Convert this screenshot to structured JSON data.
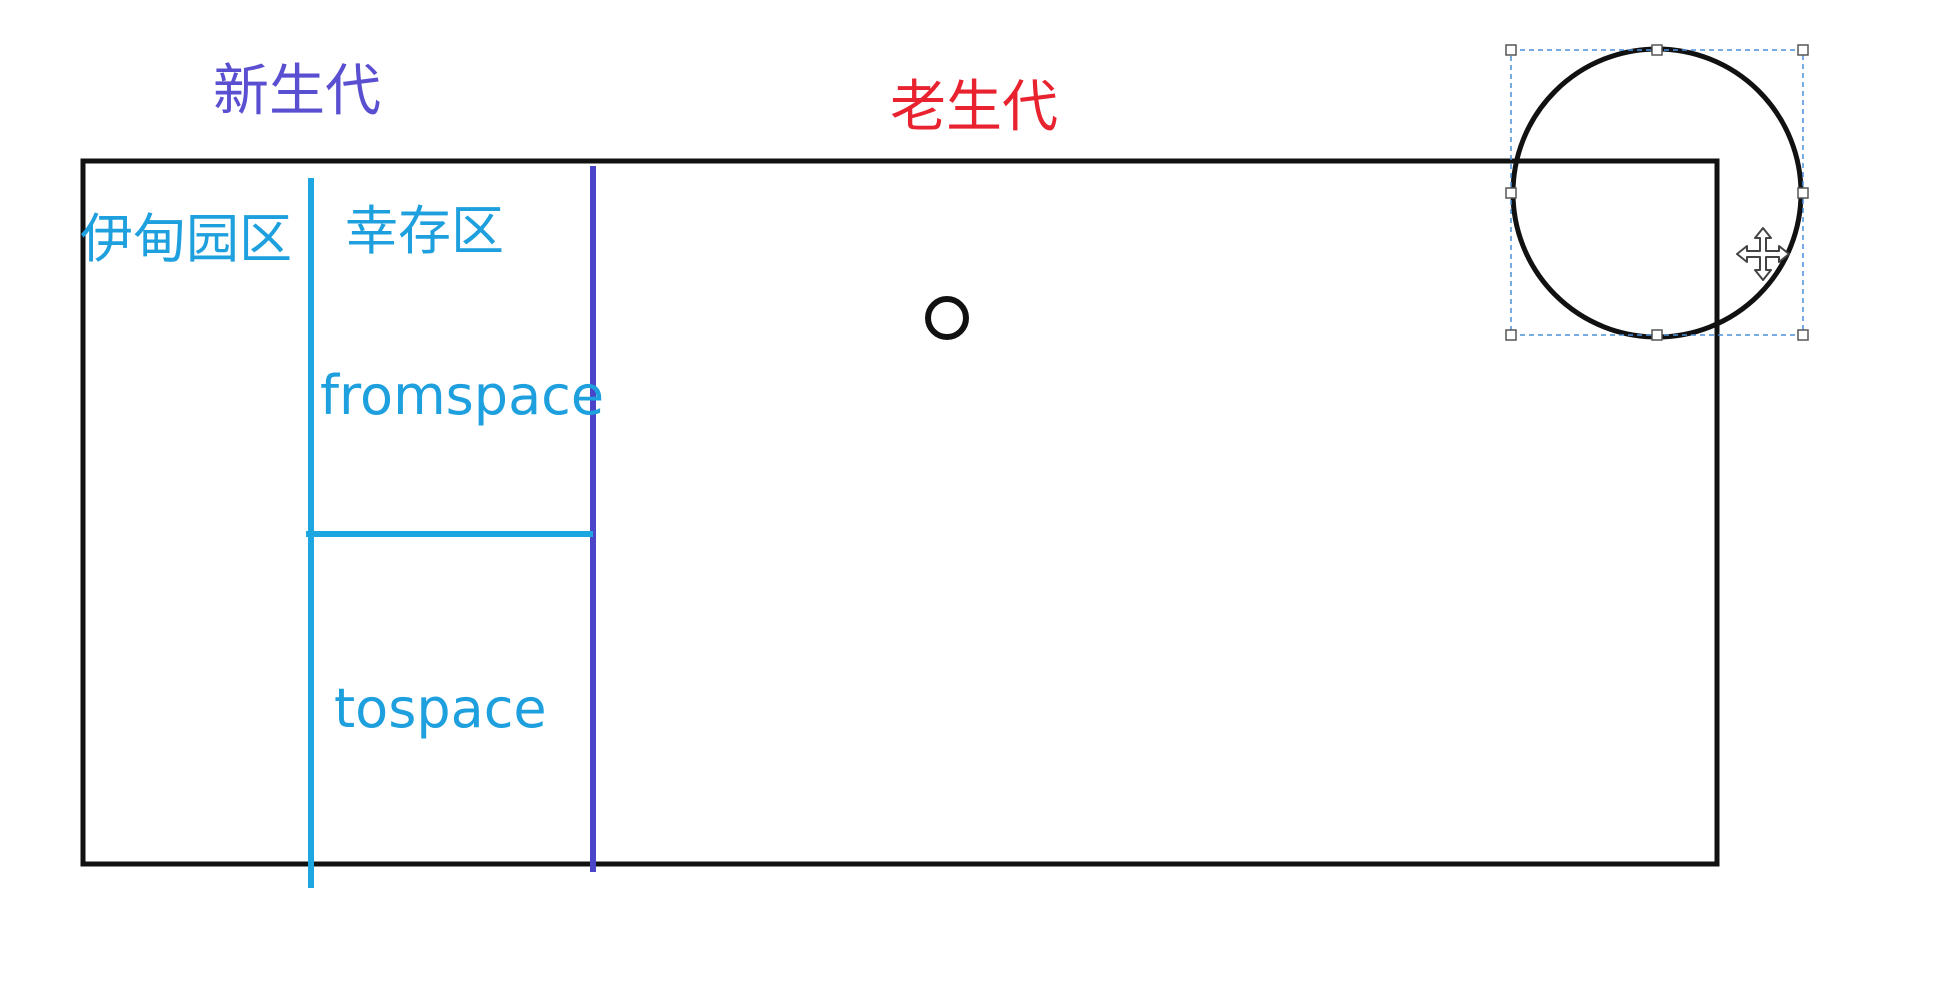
{
  "labels": {
    "young_generation": "新生代",
    "old_generation": "老生代",
    "eden": "伊甸园区",
    "survivor": "幸存区",
    "from_space": "fromspace",
    "to_space": "tospace"
  },
  "colors": {
    "young_generation": "#5a4fd0",
    "old_generation": "#e8232f",
    "cyan_text": "#1ea0de",
    "cyan_line": "#1ea6e0",
    "purple_line": "#4a45c8",
    "outline": "#111111",
    "selection": "#4a90d9"
  },
  "icons": {
    "cursor": "move-cursor-icon"
  }
}
